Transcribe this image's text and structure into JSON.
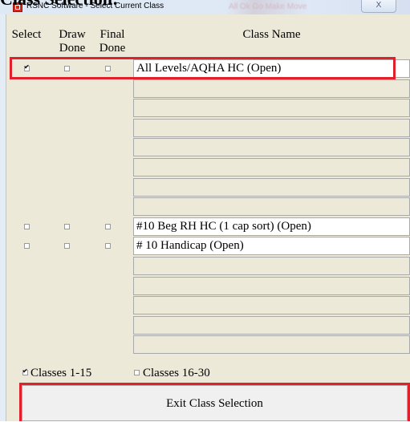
{
  "heading": "Class Selection:",
  "window": {
    "title": "RSNC Software - Select Current Class",
    "background_text": "All Ok Go Make Move",
    "close_label": "X"
  },
  "columns": {
    "select": "Select",
    "draw_done_1": "Draw",
    "draw_done_2": "Done",
    "final_done_1": "Final",
    "final_done_2": "Done",
    "class_name": "Class Name"
  },
  "classes": [
    {
      "name": "All Levels/AQHA HC (Open)",
      "select": true,
      "draw_done": false,
      "final_done": false
    },
    {
      "name": ""
    },
    {
      "name": ""
    },
    {
      "name": ""
    },
    {
      "name": ""
    },
    {
      "name": ""
    },
    {
      "name": ""
    },
    {
      "name": ""
    },
    {
      "name": "#10 Beg RH HC (1 cap sort) (Open)",
      "select": false,
      "draw_done": false,
      "final_done": false
    },
    {
      "name": "# 10 Handicap (Open)",
      "select": false,
      "draw_done": false,
      "final_done": false
    },
    {
      "name": ""
    },
    {
      "name": ""
    },
    {
      "name": ""
    },
    {
      "name": ""
    },
    {
      "name": ""
    }
  ],
  "range_options": [
    {
      "label": "Classes 1-15",
      "checked": true
    },
    {
      "label": "Classes 16-30",
      "checked": false
    }
  ],
  "exit_button": "Exit Class Selection",
  "colors": {
    "highlight_box": "#e0202a",
    "dialog_background": "#ece9d8",
    "field_background": "#ffffff"
  }
}
